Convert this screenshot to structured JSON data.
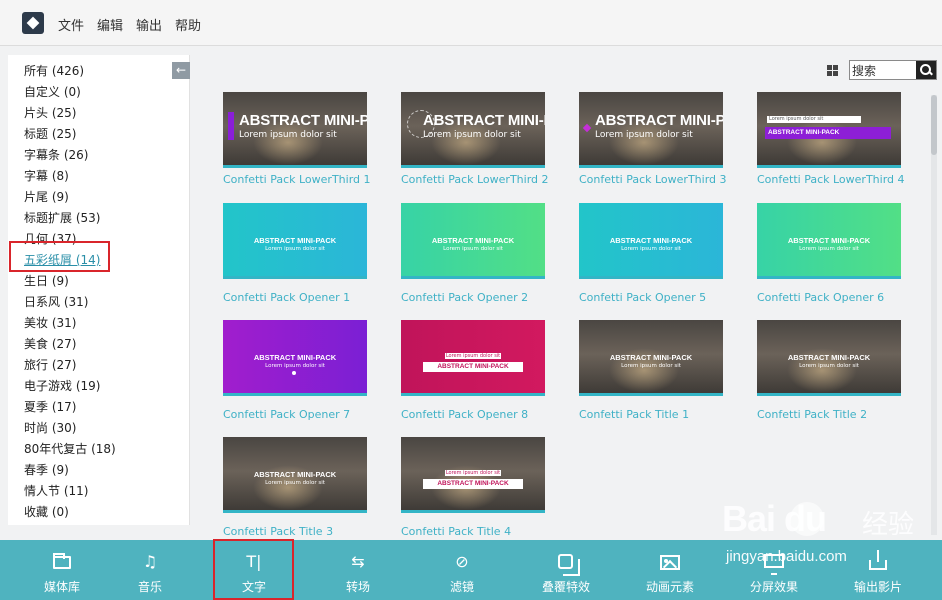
{
  "menubar": {
    "items": [
      "文件",
      "编辑",
      "输出",
      "帮助"
    ]
  },
  "sidebar": {
    "collapse_icon": "arrow-left-icon",
    "categories": [
      {
        "label": "所有 (426)"
      },
      {
        "label": "自定义 (0)"
      },
      {
        "label": "片头 (25)"
      },
      {
        "label": "标题 (25)"
      },
      {
        "label": "字幕条 (26)"
      },
      {
        "label": "字幕 (8)"
      },
      {
        "label": "片尾 (9)"
      },
      {
        "label": "标题扩展 (53)"
      },
      {
        "label": "几何 (37)"
      },
      {
        "label": "五彩纸屑 (14)",
        "active": true
      },
      {
        "label": "生日 (9)"
      },
      {
        "label": "日系风 (31)"
      },
      {
        "label": "美妆 (31)"
      },
      {
        "label": "美食 (27)"
      },
      {
        "label": "旅行 (27)"
      },
      {
        "label": "电子游戏 (19)"
      },
      {
        "label": "夏季 (17)"
      },
      {
        "label": "时尚 (30)"
      },
      {
        "label": "80年代复古 (18)"
      },
      {
        "label": "春季 (9)"
      },
      {
        "label": "情人节 (11)"
      },
      {
        "label": "收藏 (0)"
      }
    ]
  },
  "main": {
    "search": {
      "value": "搜索",
      "icon": "search-icon"
    },
    "view_icon": "grid-view-icon",
    "thumb_text": {
      "title": "ABSTRACT MINI-PACK",
      "subtitle": "Lorem ipsum dolor sit"
    },
    "items": [
      {
        "label": "Confetti Pack LowerThird 1"
      },
      {
        "label": "Confetti Pack LowerThird 2"
      },
      {
        "label": "Confetti Pack LowerThird 3"
      },
      {
        "label": "Confetti Pack LowerThird 4"
      },
      {
        "label": "Confetti Pack Opener 1"
      },
      {
        "label": "Confetti Pack Opener 2"
      },
      {
        "label": "Confetti Pack Opener 5"
      },
      {
        "label": "Confetti Pack Opener 6"
      },
      {
        "label": "Confetti Pack Opener 7"
      },
      {
        "label": "Confetti Pack Opener 8"
      },
      {
        "label": "Confetti Pack Title 1"
      },
      {
        "label": "Confetti Pack Title 2"
      },
      {
        "label": "Confetti Pack Title 3"
      },
      {
        "label": "Confetti Pack Title 4"
      }
    ]
  },
  "toolbar": {
    "items": [
      {
        "label": "媒体库",
        "icon": "folder-icon"
      },
      {
        "label": "音乐",
        "icon": "music-note-icon"
      },
      {
        "label": "文字",
        "icon": "text-cursor-icon",
        "active": true
      },
      {
        "label": "转场",
        "icon": "transition-icon"
      },
      {
        "label": "滤镜",
        "icon": "filter-icon"
      },
      {
        "label": "叠覆特效",
        "icon": "overlay-icon"
      },
      {
        "label": "动画元素",
        "icon": "image-icon"
      },
      {
        "label": "分屏效果",
        "icon": "split-screen-icon"
      },
      {
        "label": "输出影片",
        "icon": "export-icon"
      }
    ]
  },
  "colors": {
    "accent": "#4fb3bf",
    "link": "#3fb1c6",
    "highlight_box": "#d9252b"
  },
  "watermark": {
    "brand": "Bai du",
    "cn": "经验",
    "url": "jingyan.baidu.com"
  }
}
